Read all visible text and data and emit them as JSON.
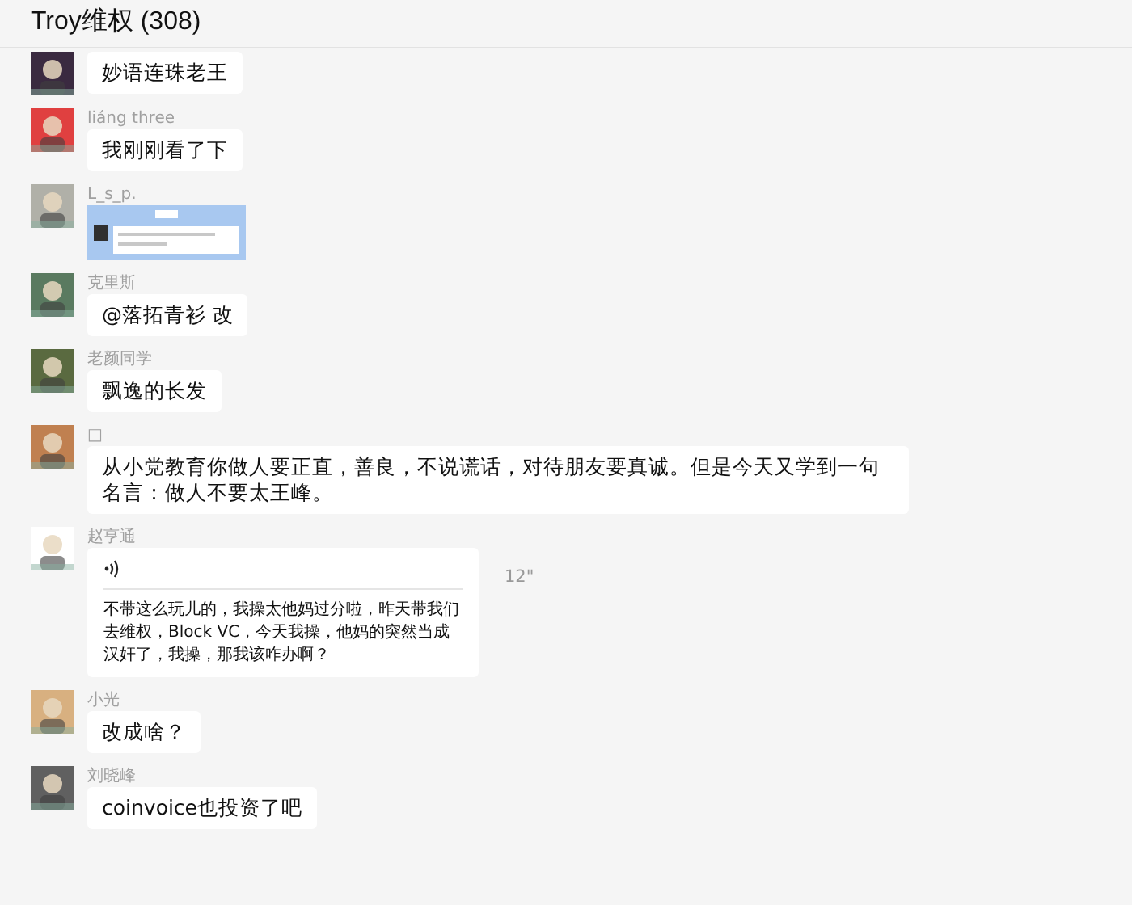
{
  "window": {
    "title": "Troy维权 (308)"
  },
  "messages": [
    {
      "kind": "text",
      "text": "妙语连珠老王"
    },
    {
      "kind": "text",
      "sender": "liáng three",
      "text": "我刚刚看了下"
    },
    {
      "sender": "L_s_p."
    },
    {
      "kind": "text",
      "sender": "克里斯",
      "text": "@落拓青衫 改"
    },
    {
      "kind": "text",
      "sender": "老颜同学",
      "text": "飘逸的长发"
    },
    {
      "kind": "text",
      "sender": "□",
      "text": "从小党教育你做人要正直，善良，不说谎话，对待朋友要真诚。但是今天又学到一句名言：做人不要太王峰。"
    },
    {
      "kind": "voice",
      "sender": "赵亨通",
      "duration": "12\"",
      "text": "不带这么玩儿的，我操太他妈过分啦，昨天带我们去维权，Block VC，今天我操，他妈的突然当成汉奸了，我操，那我该咋办啊？"
    },
    {
      "kind": "text",
      "sender": "小光",
      "text": "改成啥？"
    },
    {
      "kind": "text",
      "sender": "刘晓峰",
      "text": "coinvoice也投资了吧"
    }
  ]
}
